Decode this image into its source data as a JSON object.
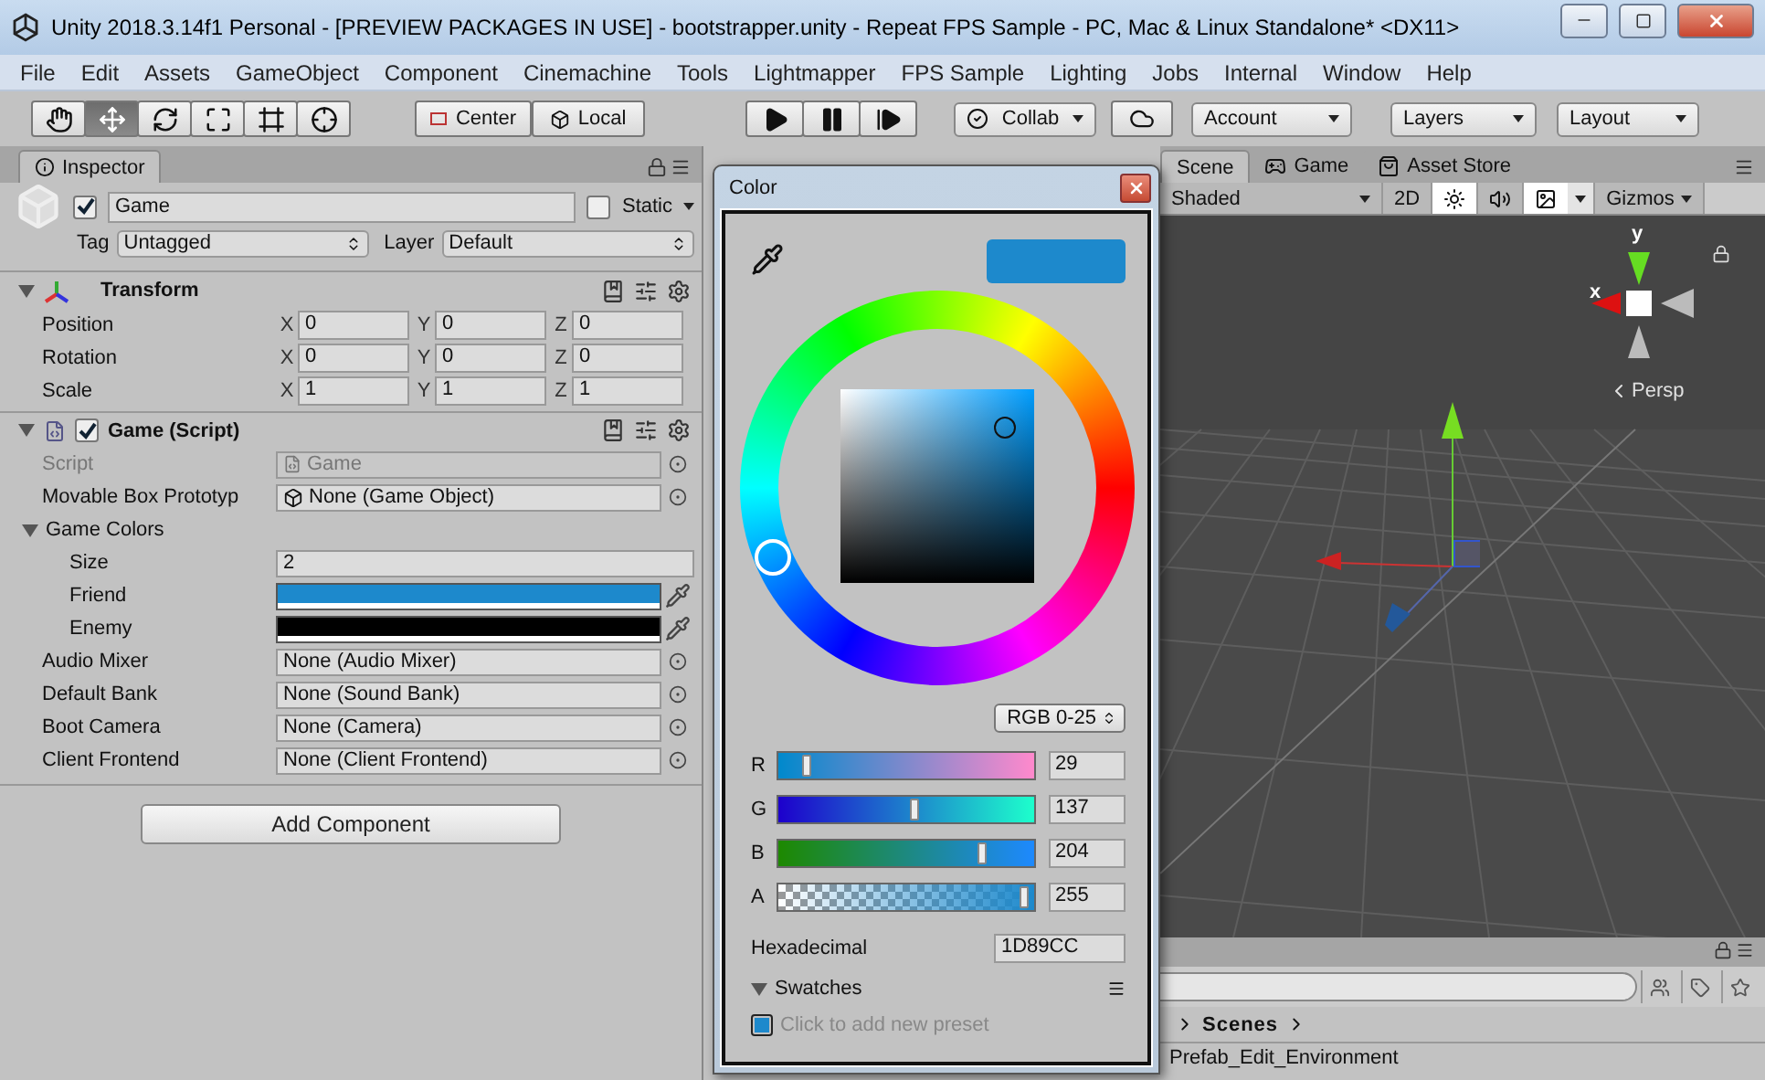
{
  "window": {
    "title": "Unity 2018.3.14f1 Personal - [PREVIEW PACKAGES IN USE] - bootstrapper.unity - Repeat FPS Sample - PC, Mac & Linux Standalone* <DX11>"
  },
  "menu": [
    "File",
    "Edit",
    "Assets",
    "GameObject",
    "Component",
    "Cinemachine",
    "Tools",
    "Lightmapper",
    "FPS Sample",
    "Lighting",
    "Jobs",
    "Internal",
    "Window",
    "Help"
  ],
  "toolbar": {
    "tools": [
      {
        "kind": "hand",
        "selected": false
      },
      {
        "kind": "move",
        "selected": true
      },
      {
        "kind": "rotate",
        "selected": false
      },
      {
        "kind": "scale",
        "selected": false
      },
      {
        "kind": "rect",
        "selected": false
      },
      {
        "kind": "transform",
        "selected": false
      }
    ],
    "pivot": [
      "Center",
      "Local"
    ],
    "play": [
      {
        "kind": "play"
      },
      {
        "kind": "pause"
      },
      {
        "kind": "step"
      }
    ],
    "collab": "Collab",
    "account": "Account",
    "layers": "Layers",
    "layout": "Layout"
  },
  "inspector": {
    "tab": "Inspector",
    "object": {
      "active": true,
      "name": "Game",
      "static": false,
      "static_label": "Static",
      "tag_label": "Tag",
      "tag": "Untagged",
      "layer_label": "Layer",
      "layer": "Default"
    },
    "transform": {
      "title": "Transform",
      "expanded": true,
      "rows": [
        {
          "label": "Position",
          "values": [
            {
              "axis": "X",
              "value": "0"
            },
            {
              "axis": "Y",
              "value": "0"
            },
            {
              "axis": "Z",
              "value": "0"
            }
          ]
        },
        {
          "label": "Rotation",
          "values": [
            {
              "axis": "X",
              "value": "0"
            },
            {
              "axis": "Y",
              "value": "0"
            },
            {
              "axis": "Z",
              "value": "0"
            }
          ]
        },
        {
          "label": "Scale",
          "values": [
            {
              "axis": "X",
              "value": "1"
            },
            {
              "axis": "Y",
              "value": "1"
            },
            {
              "axis": "Z",
              "value": "1"
            }
          ]
        }
      ]
    },
    "script": {
      "title": "Game (Script)",
      "enabled": true,
      "expanded": true,
      "fields": [
        {
          "kind": "script_ref",
          "label": "Script",
          "value": "Game",
          "disabled": true
        },
        {
          "kind": "object_ref",
          "label": "Movable Box Prototyp",
          "value": "None (Game Object)",
          "disabled": false
        },
        {
          "kind": "foldout",
          "label": "Game Colors",
          "expanded": true,
          "children": [
            {
              "kind": "number",
              "label": "Size",
              "value": "2"
            },
            {
              "kind": "color",
              "label": "Friend",
              "color": "#1d89cc"
            },
            {
              "kind": "color",
              "label": "Enemy",
              "color": "#000000"
            }
          ]
        },
        {
          "kind": "object",
          "label": "Audio Mixer",
          "value": "None (Audio Mixer)",
          "disabled": false
        },
        {
          "kind": "object",
          "label": "Default Bank",
          "value": "None (Sound Bank)",
          "disabled": false
        },
        {
          "kind": "object",
          "label": "Boot Camera",
          "value": "None (Camera)",
          "disabled": false
        },
        {
          "kind": "object",
          "label": "Client Frontend",
          "value": "None (Client Frontend)",
          "disabled": false
        }
      ]
    },
    "add_button": "Add Component"
  },
  "color_picker": {
    "title": "Color",
    "mode": "RGB 0-25",
    "channels": [
      {
        "label": "R",
        "level": 0.114,
        "value": "29"
      },
      {
        "label": "G",
        "level": 0.537,
        "value": "137"
      },
      {
        "label": "B",
        "level": 0.8,
        "value": "204"
      },
      {
        "label": "A",
        "level": 1,
        "value": "255"
      }
    ],
    "hex_label": "Hexadecimal",
    "hex": "1D89CC",
    "swatches": {
      "label": "Swatches",
      "expanded": true,
      "hint": "Click to add new preset"
    }
  },
  "scene": {
    "tabs": [
      {
        "kind": "scene",
        "label": "Scene",
        "selected": true
      },
      {
        "kind": "game",
        "label": "Game",
        "selected": false
      },
      {
        "kind": "store",
        "label": "Asset Store",
        "selected": false
      }
    ],
    "shading": "Shaded",
    "mode_2d": "2D",
    "lighting_on": true,
    "audio_on": false,
    "effects_on": true,
    "gizmos": "Gizmos",
    "axis_y": "y",
    "axis_x": "x",
    "projection": "Persp"
  },
  "project": {
    "breadcrumb": "Scenes",
    "items": [
      "Prefab_Edit_Environment"
    ]
  }
}
